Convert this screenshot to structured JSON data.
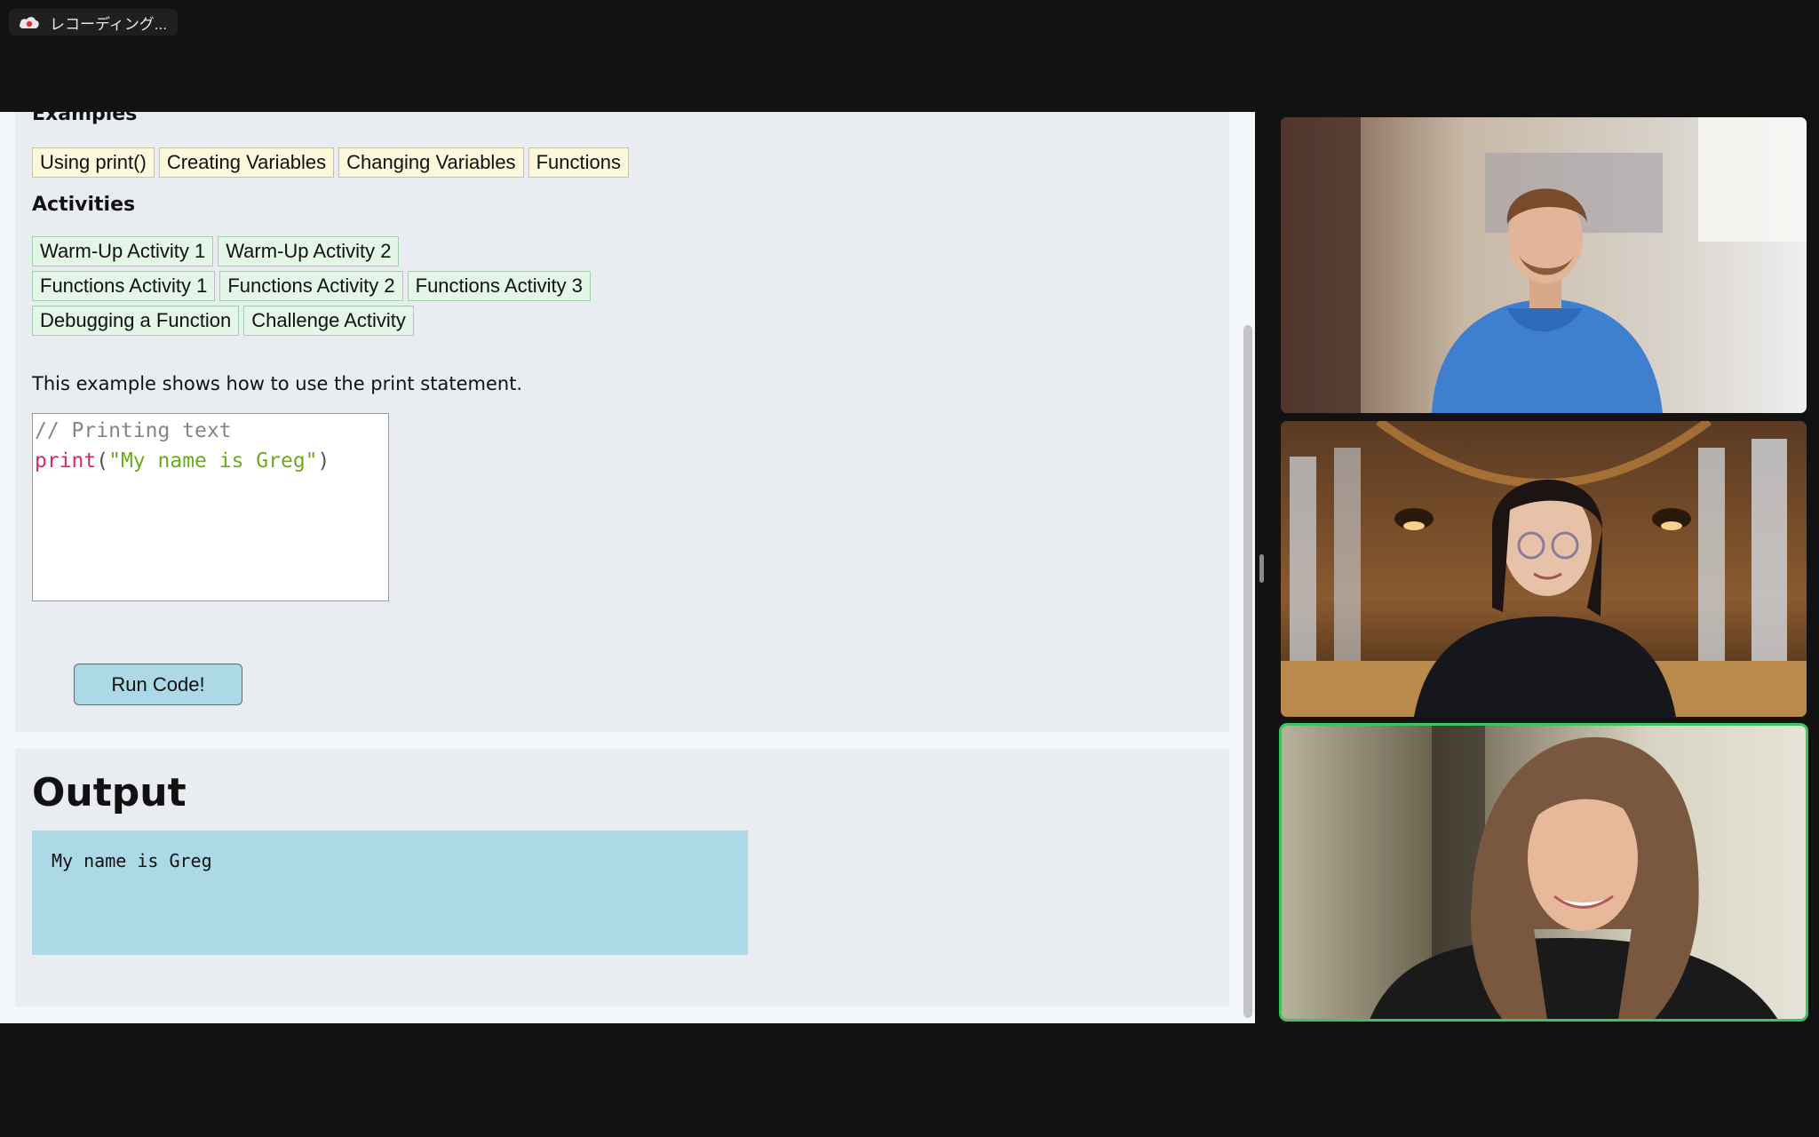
{
  "recording": {
    "label": "レコーディング..."
  },
  "lesson": {
    "examples_heading": "Examples",
    "examples": [
      "Using print()",
      "Creating Variables",
      "Changing Variables",
      "Functions"
    ],
    "activities_heading": "Activities",
    "activities_rows": [
      [
        "Warm-Up Activity 1",
        "Warm-Up Activity 2"
      ],
      [
        "Functions Activity 1",
        "Functions Activity 2",
        "Functions Activity 3"
      ],
      [
        "Debugging a Function",
        "Challenge Activity"
      ]
    ],
    "description": "This example shows how to use the print statement.",
    "code": {
      "comment": "// Printing text",
      "keyword": "print",
      "open_paren": "(",
      "string": "\"My name is Greg\"",
      "close_paren": ")"
    },
    "run_button": "Run Code!",
    "output_heading": "Output",
    "output_text": "My name is Greg"
  },
  "participants": [
    {
      "role": "participant-1",
      "active_speaker": false,
      "shirt_color": "#3f7fd0"
    },
    {
      "role": "participant-2",
      "active_speaker": false,
      "shirt_color": "#15171c"
    },
    {
      "role": "participant-3",
      "active_speaker": true,
      "shirt_color": "#1a1a1a"
    }
  ],
  "colors": {
    "active_speaker_border": "#3ec45c",
    "example_chip": "#fbf8dc",
    "activity_chip": "#e3f6e8",
    "run_button": "#add8e6",
    "output_box": "#add8e6"
  }
}
